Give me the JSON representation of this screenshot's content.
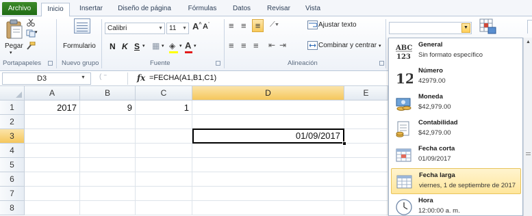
{
  "tabs": [
    {
      "label": "Archivo"
    },
    {
      "label": "Inicio"
    },
    {
      "label": "Insertar"
    },
    {
      "label": "Diseño de página"
    },
    {
      "label": "Fórmulas"
    },
    {
      "label": "Datos"
    },
    {
      "label": "Revisar"
    },
    {
      "label": "Vista"
    }
  ],
  "ribbon": {
    "clipboard": {
      "paste_label": "Pegar",
      "group_label": "Portapapeles"
    },
    "nuevo_grupo": {
      "button_label": "Formulario",
      "group_label": "Nuevo grupo"
    },
    "font": {
      "font_name": "Calibri",
      "font_size": "11",
      "bold": "N",
      "italic": "K",
      "underline": "S",
      "group_label": "Fuente"
    },
    "alignment": {
      "wrap_label": "Ajustar texto",
      "merge_label": "Combinar y centrar",
      "group_label": "Alineación"
    }
  },
  "formula_bar": {
    "name_box": "D3",
    "fx": "fx",
    "formula": "=FECHA(A1,B1,C1)"
  },
  "grid": {
    "columns": [
      "A",
      "B",
      "C",
      "D",
      "E"
    ],
    "rows": [
      "1",
      "2",
      "3",
      "4",
      "5",
      "6",
      "7",
      "8"
    ],
    "cells": {
      "A1": "2017",
      "B1": "9",
      "C1": "1",
      "D3": "01/09/2017"
    },
    "selected": "D3"
  },
  "number_format_gallery": [
    {
      "name": "General",
      "sample": "Sin formato específico",
      "icon": "abc-123-icon"
    },
    {
      "name": "Número",
      "sample": "42979.00",
      "icon": "number-12-icon"
    },
    {
      "name": "Moneda",
      "sample": "$42,979.00",
      "icon": "currency-icon"
    },
    {
      "name": "Contabilidad",
      "sample": "$42,979.00",
      "icon": "accounting-icon"
    },
    {
      "name": "Fecha corta",
      "sample": "01/09/2017",
      "icon": "calendar-short-icon"
    },
    {
      "name": "Fecha larga",
      "sample": "viernes, 1 de septiembre de 2017",
      "icon": "calendar-long-icon",
      "hovered": true
    },
    {
      "name": "Hora",
      "sample": "12:00:00 a. m.",
      "icon": "clock-icon"
    }
  ],
  "colors": {
    "archivo_tab": "#2f7d1f",
    "selection_header": "#f5c75c",
    "hover_item": "#ffe69b"
  }
}
